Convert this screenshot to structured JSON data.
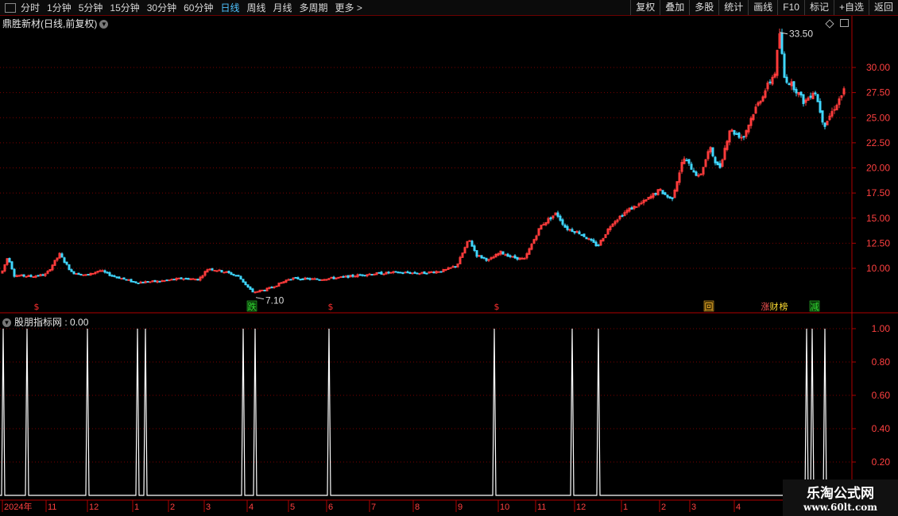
{
  "toolbar": {
    "periods": [
      "分时",
      "1分钟",
      "5分钟",
      "15分钟",
      "30分钟",
      "60分钟",
      "日线",
      "周线",
      "月线",
      "多周期",
      "更多 >"
    ],
    "active_period": "日线",
    "actions": [
      "复权",
      "叠加",
      "多股",
      "统计",
      "画线",
      "F10",
      "标记",
      "+自选",
      "返回"
    ]
  },
  "price_panel": {
    "title": "鼎胜新材(日线,前复权)",
    "y_ticks": [
      "30.00",
      "27.50",
      "25.00",
      "22.50",
      "20.00",
      "17.50",
      "15.00",
      "12.50",
      "10.00"
    ],
    "high_label": "33.50",
    "low_label": "7.10",
    "markers": [
      {
        "text": "$",
        "color": "#ff3030"
      },
      {
        "text": "跌",
        "color": "#33dd33"
      },
      {
        "text": "$",
        "color": "#ff3030"
      },
      {
        "text": "$",
        "color": "#ff3030"
      },
      {
        "text": "回",
        "color": "#ffbb33"
      },
      {
        "text": "涨",
        "color": "#ff5555"
      },
      {
        "text": "财",
        "color": "#ffdd33"
      },
      {
        "text": "榜",
        "color": "#ffdd33"
      },
      {
        "text": "减",
        "color": "#33dd33"
      }
    ]
  },
  "indicator_panel": {
    "title": "股朋指标网",
    "value": "0.00",
    "y_ticks": [
      "1.00",
      "0.80",
      "0.60",
      "0.40",
      "0.20"
    ]
  },
  "time_axis": {
    "labels": [
      "2024年",
      "11",
      "12",
      "1",
      "2",
      "3",
      "4",
      "5",
      "6",
      "7",
      "8",
      "9",
      "10",
      "11",
      "12",
      "1",
      "2",
      "3",
      "4"
    ]
  },
  "watermark": {
    "name": "乐淘公式网",
    "url": "www.60lt.com"
  },
  "colors": {
    "up": "#ff3b3b",
    "down": "#3fd7ff",
    "grid": "#7a0000",
    "active": "#4fc3ff"
  }
}
